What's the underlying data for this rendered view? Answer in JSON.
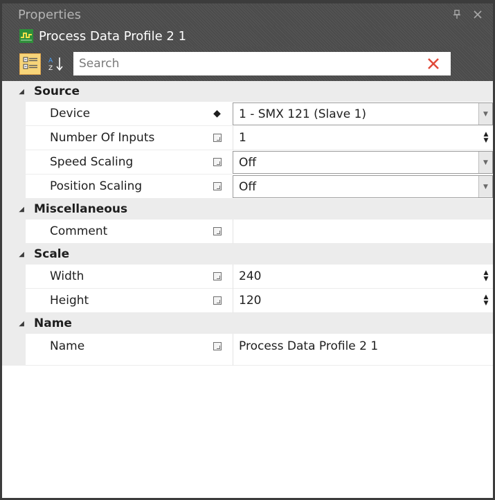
{
  "window": {
    "title": "Properties",
    "pin_icon": "pin-icon",
    "close_icon": "close-icon"
  },
  "object": {
    "name": "Process Data Profile 2 1",
    "icon": "process-data-profile-icon"
  },
  "toolbar": {
    "categorized_icon": "categorized-view-icon",
    "alphabetical_icon": "sort-az-icon",
    "search_placeholder": "Search",
    "search_value": "",
    "clear_icon": "clear-search-icon"
  },
  "colors": {
    "header_bg": "#4b4b4b",
    "category_bg": "#ececec",
    "active_tool": "#f7d57a",
    "clear_x": "#e04a3a"
  },
  "categories": [
    {
      "name": "Source",
      "properties": [
        {
          "name": "Device",
          "marker": "diamond",
          "value": "1 - SMX 121 (Slave 1)",
          "editor": "dropdown"
        },
        {
          "name": "Number Of Inputs",
          "marker": "box",
          "value": "1",
          "editor": "spinner"
        },
        {
          "name": "Speed Scaling",
          "marker": "box",
          "value": "Off",
          "editor": "dropdown"
        },
        {
          "name": "Position Scaling",
          "marker": "box",
          "value": "Off",
          "editor": "dropdown"
        }
      ]
    },
    {
      "name": "Miscellaneous",
      "properties": [
        {
          "name": "Comment",
          "marker": "box",
          "value": "",
          "editor": "text"
        }
      ]
    },
    {
      "name": "Scale",
      "properties": [
        {
          "name": "Width",
          "marker": "box",
          "value": "240",
          "editor": "spinner"
        },
        {
          "name": "Height",
          "marker": "box",
          "value": "120",
          "editor": "spinner"
        }
      ]
    },
    {
      "name": "Name",
      "properties": [
        {
          "name": "Name",
          "marker": "box",
          "value": "Process Data Profile 2 1",
          "editor": "text"
        }
      ]
    }
  ]
}
